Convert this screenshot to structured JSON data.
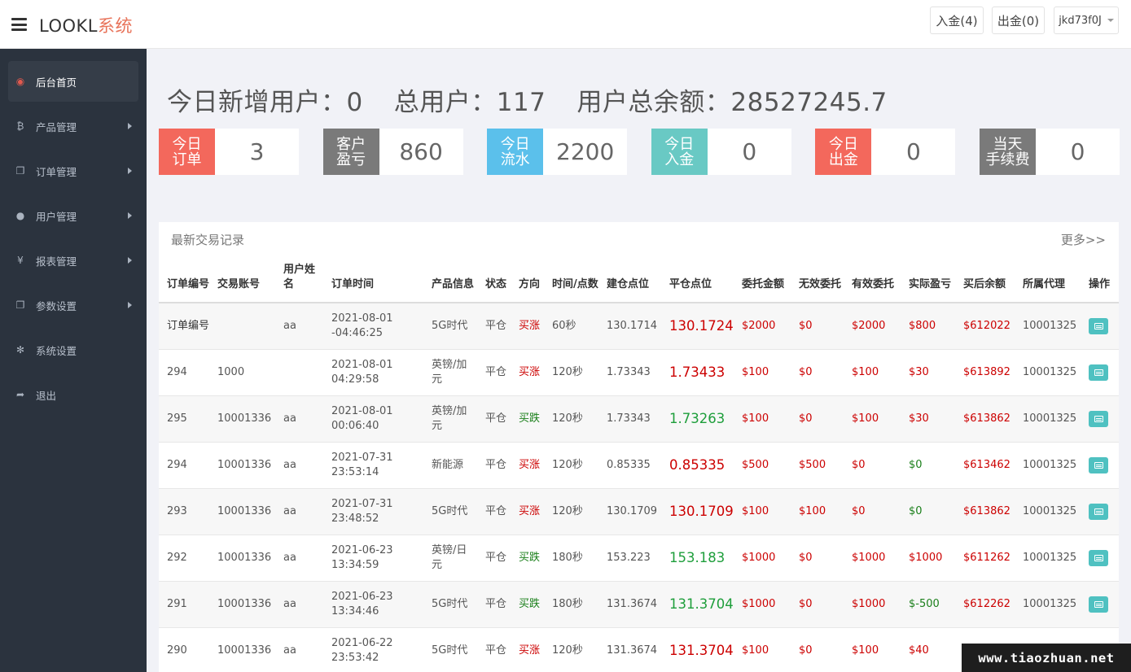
{
  "header": {
    "brand_main": "LOOKL",
    "brand_accent": "系统",
    "deposit_btn": "入金(4)",
    "withdraw_btn": "出金(0)",
    "user": "jkd73f0J"
  },
  "sidebar": {
    "items": [
      {
        "label": "后台首页",
        "icon": "dashboard-icon"
      },
      {
        "label": "产品管理",
        "icon": "bitcoin-icon"
      },
      {
        "label": "订单管理",
        "icon": "copy-icon"
      },
      {
        "label": "用户管理",
        "icon": "user-icon"
      },
      {
        "label": "报表管理",
        "icon": "yen-icon"
      },
      {
        "label": "参数设置",
        "icon": "copy-icon"
      },
      {
        "label": "系统设置",
        "icon": "gears-icon"
      },
      {
        "label": "退出",
        "icon": "sign-out-icon"
      }
    ]
  },
  "summary": {
    "new_users_label": "今日新增用户：",
    "new_users": "0",
    "total_users_label": "总用户：",
    "total_users": "117",
    "balance_label": "用户总余额：",
    "balance": "28527245.7"
  },
  "cards": [
    {
      "line1": "今日",
      "line2": "订单",
      "value": "3",
      "color": "#f3685c"
    },
    {
      "line1": "客户",
      "line2": "盈亏",
      "value": "860",
      "color": "#7a7a7a"
    },
    {
      "line1": "今日",
      "line2": "流水",
      "value": "2200",
      "color": "#5bc0eb"
    },
    {
      "line1": "今日",
      "line2": "入金",
      "value": "0",
      "color": "#69c9c4"
    },
    {
      "line1": "今日",
      "line2": "出金",
      "value": "0",
      "color": "#f3685c"
    },
    {
      "line1": "当天",
      "line2": "手续费",
      "value": "0",
      "color": "#7a7a7a"
    }
  ],
  "panel": {
    "title": "最新交易记录",
    "more": "更多>>"
  },
  "table": {
    "headers": [
      "订单编号",
      "交易账号",
      "用户姓名",
      "订单时间",
      "产品信息",
      "状态",
      "方向",
      "时间/点数",
      "建仓点位",
      "平仓点位",
      "委托金额",
      "无效委托",
      "有效委托",
      "实际盈亏",
      "买后余额",
      "所属代理",
      "操作"
    ],
    "rows": [
      {
        "id": "订单编号",
        "account": "",
        "name": "aa",
        "date": "2021-08-01",
        "time": "-04:46:25",
        "product": "5G时代",
        "status": "平仓",
        "dir": "买涨",
        "dir_up": true,
        "period": "60秒",
        "open": "130.1714",
        "close": "130.1724",
        "entrust": "$2000",
        "invalid": "$0",
        "valid": "$2000",
        "pnl": "$800",
        "pnl_pos": true,
        "balance": "$612022",
        "agent": "10001325"
      },
      {
        "id": "294",
        "account": "1000",
        "name": "",
        "date": "2021-08-01",
        "time": "04:29:58",
        "product": "英镑/加元",
        "status": "平仓",
        "dir": "买涨",
        "dir_up": true,
        "period": "120秒",
        "open": "1.73343",
        "close": "1.73433",
        "entrust": "$100",
        "invalid": "$0",
        "valid": "$100",
        "pnl": "$30",
        "pnl_pos": true,
        "balance": "$613892",
        "agent": "10001325"
      },
      {
        "id": "295",
        "account": "10001336",
        "name": "aa",
        "date": "2021-08-01",
        "time": "00:06:40",
        "product": "英镑/加元",
        "status": "平仓",
        "dir": "买跌",
        "dir_up": false,
        "period": "120秒",
        "open": "1.73343",
        "close": "1.73263",
        "entrust": "$100",
        "invalid": "$0",
        "valid": "$100",
        "pnl": "$30",
        "pnl_pos": true,
        "balance": "$613862",
        "agent": "10001325"
      },
      {
        "id": "294",
        "account": "10001336",
        "name": "aa",
        "date": "2021-07-31",
        "time": "23:53:14",
        "product": "新能源",
        "status": "平仓",
        "dir": "买涨",
        "dir_up": true,
        "period": "120秒",
        "open": "0.85335",
        "close": "0.85335",
        "entrust": "$500",
        "invalid": "$500",
        "valid": "$0",
        "pnl": "$0",
        "pnl_pos": false,
        "balance": "$613462",
        "agent": "10001325"
      },
      {
        "id": "293",
        "account": "10001336",
        "name": "aa",
        "date": "2021-07-31",
        "time": "23:48:52",
        "product": "5G时代",
        "status": "平仓",
        "dir": "买涨",
        "dir_up": true,
        "period": "120秒",
        "open": "130.1709",
        "close": "130.1709",
        "entrust": "$100",
        "invalid": "$100",
        "valid": "$0",
        "pnl": "$0",
        "pnl_pos": false,
        "balance": "$613862",
        "agent": "10001325"
      },
      {
        "id": "292",
        "account": "10001336",
        "name": "aa",
        "date": "2021-06-23",
        "time": "13:34:59",
        "product": "英镑/日元",
        "status": "平仓",
        "dir": "买跌",
        "dir_up": false,
        "period": "180秒",
        "open": "153.223",
        "close": "153.183",
        "entrust": "$1000",
        "invalid": "$0",
        "valid": "$1000",
        "pnl": "$1000",
        "pnl_pos": true,
        "balance": "$611262",
        "agent": "10001325"
      },
      {
        "id": "291",
        "account": "10001336",
        "name": "aa",
        "date": "2021-06-23",
        "time": "13:34:46",
        "product": "5G时代",
        "status": "平仓",
        "dir": "买跌",
        "dir_up": false,
        "period": "180秒",
        "open": "131.3674",
        "close": "131.3704",
        "entrust": "$1000",
        "invalid": "$0",
        "valid": "$1000",
        "pnl": "$-500",
        "pnl_pos": false,
        "balance": "$612262",
        "agent": "10001325"
      },
      {
        "id": "290",
        "account": "10001336",
        "name": "aa",
        "date": "2021-06-22",
        "time": "23:53:42",
        "product": "5G时代",
        "status": "平仓",
        "dir": "买涨",
        "dir_up": true,
        "period": "120秒",
        "open": "131.3674",
        "close": "131.3704",
        "entrust": "$100",
        "invalid": "$0",
        "valid": "$100",
        "pnl": "$40",
        "pnl_pos": true,
        "balance": "",
        "agent": ""
      }
    ]
  },
  "watermark": "www.tiaozhuan.net"
}
